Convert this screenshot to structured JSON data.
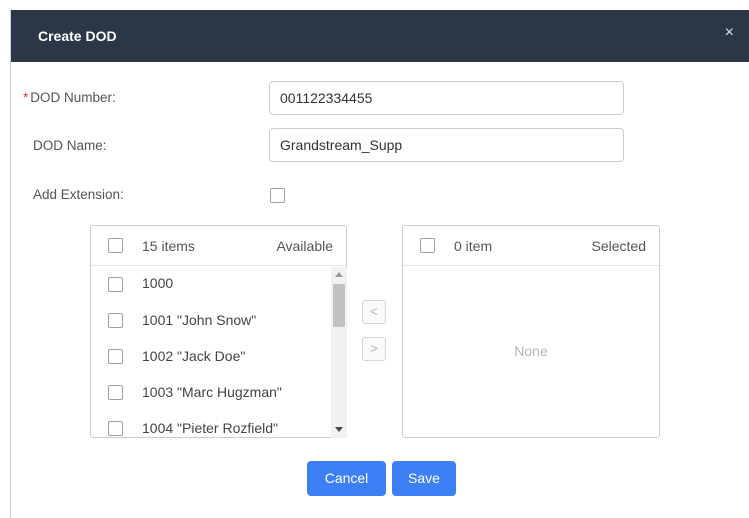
{
  "dialog": {
    "title": "Create DOD",
    "close_glyph": "×"
  },
  "form": {
    "dod_number": {
      "required_mark": "*",
      "label": "DOD Number:",
      "value": "001122334455"
    },
    "dod_name": {
      "label": "DOD Name:",
      "value": "Grandstream_Supp"
    },
    "add_extension": {
      "label": "Add Extension:",
      "checked": false
    }
  },
  "available_panel": {
    "count": "15 items",
    "title": "Available",
    "items": [
      "1000",
      "1001 \"John Snow\"",
      "1002 \"Jack Doe\"",
      "1003 \"Marc Hugzman\"",
      "1004 \"Pieter Rozfield\""
    ]
  },
  "transfer": {
    "to_left": "<",
    "to_right": ">"
  },
  "selected_panel": {
    "count": "0 item",
    "title": "Selected",
    "empty_text": "None"
  },
  "footer": {
    "cancel_label": "Cancel",
    "save_label": "Save"
  },
  "colors": {
    "titlebar": "#2b3647",
    "primary_button": "#3d7ff5",
    "required": "#e23b3b"
  }
}
